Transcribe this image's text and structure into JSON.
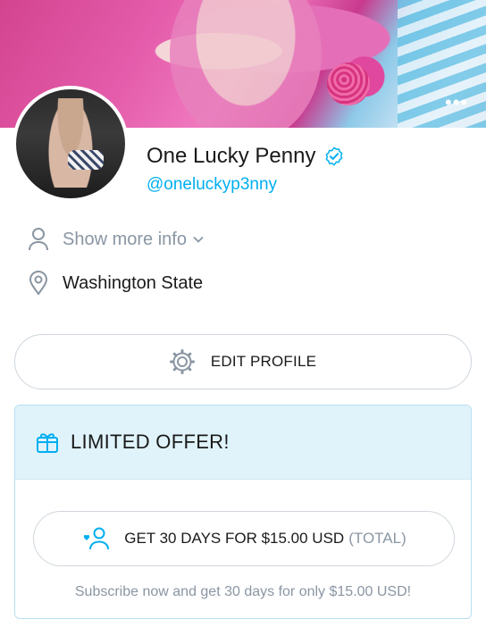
{
  "profile": {
    "name": "One Lucky Penny",
    "handle": "@oneluckyp3nny",
    "verified": true
  },
  "cover": {
    "more_label": "•••"
  },
  "info": {
    "show_more_label": "Show more info",
    "location": "Washington State"
  },
  "actions": {
    "edit_profile_label": "EDIT PROFILE"
  },
  "offer": {
    "title": "LIMITED OFFER!",
    "subscribe_label": "GET 30 DAYS FOR $15.00 USD",
    "subscribe_suffix": "(TOTAL)",
    "note": "Subscribe now and get 30 days for only $15.00 USD!"
  },
  "colors": {
    "accent": "#00aff0",
    "muted": "#8a96a3",
    "offer_bg": "#e0f3fb"
  },
  "icons": [
    "user-icon",
    "chevron-down-icon",
    "location-pin-icon",
    "gear-icon",
    "gift-icon",
    "subscribe-user-icon",
    "verified-icon",
    "more-icon"
  ]
}
